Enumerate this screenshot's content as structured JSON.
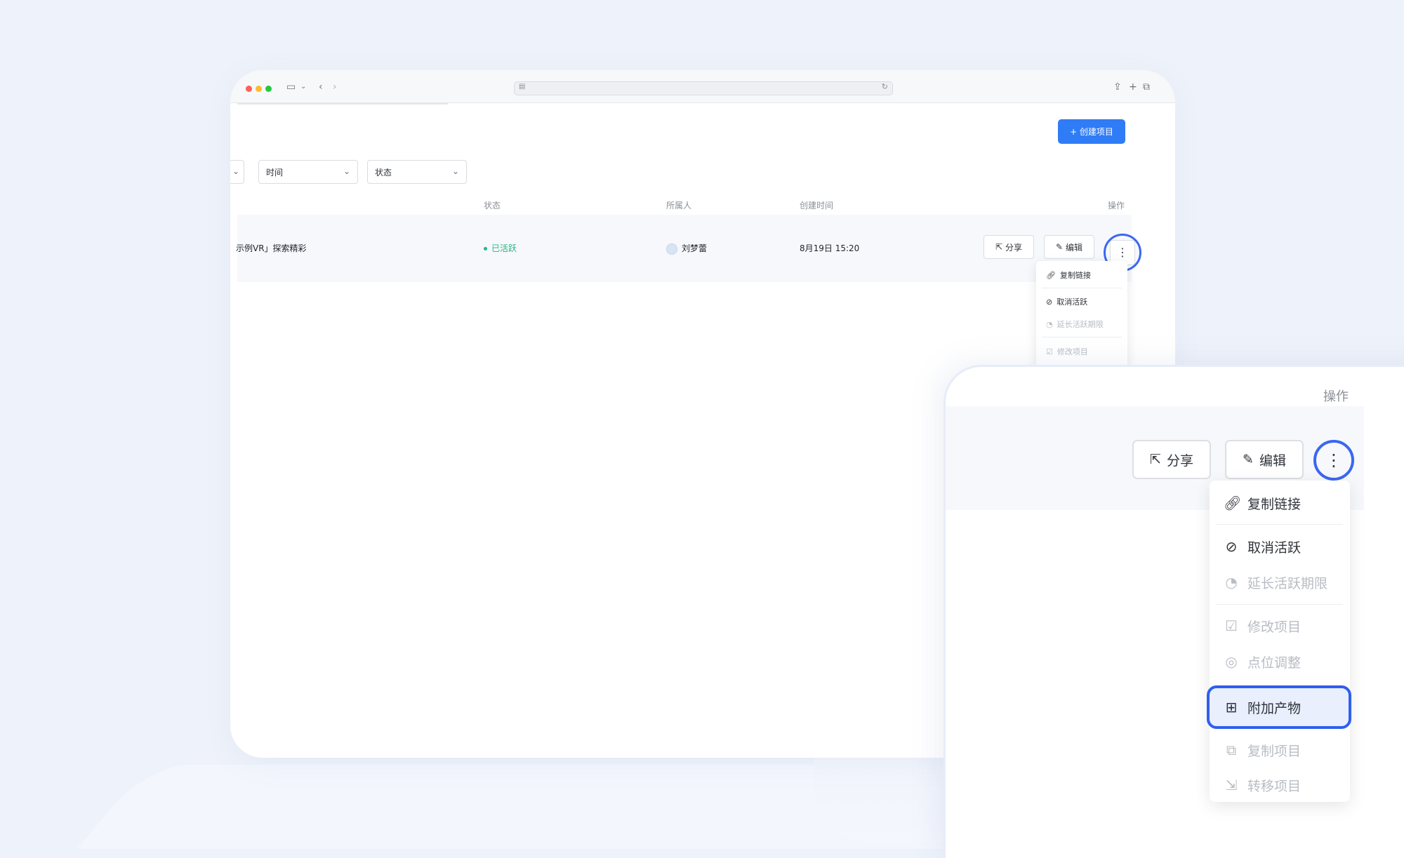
{
  "toolbar": {
    "create_label": "+ 创建项目"
  },
  "filters": [
    {
      "label": "时间"
    },
    {
      "label": "状态"
    }
  ],
  "table": {
    "headers": {
      "status": "状态",
      "owner": "所属人",
      "created": "创建时间",
      "actions": "操作"
    },
    "row": {
      "name": "示例VR」探索精彩",
      "status": "已活跃",
      "owner": "刘梦蕾",
      "created": "8月19日 15:20"
    },
    "buttons": {
      "share": "分享",
      "edit": "编辑"
    }
  },
  "menu": {
    "items": [
      {
        "label": "复制链接",
        "enabled": true,
        "icon": "link-icon"
      },
      {
        "label": "取消活跃",
        "enabled": true,
        "icon": "deactivate-icon"
      },
      {
        "label": "延长活跃期限",
        "enabled": false,
        "icon": "clock-icon"
      },
      {
        "label": "修改项目",
        "enabled": false,
        "icon": "edit-square-icon"
      },
      {
        "label": "点位调整",
        "enabled": false,
        "icon": "target-icon"
      },
      {
        "label": "附加产物",
        "enabled": true,
        "icon": "apps-icon"
      },
      {
        "label": "复制项目",
        "enabled": false,
        "icon": "copy-icon"
      },
      {
        "label": "转移项目",
        "enabled": false,
        "icon": "transfer-icon"
      }
    ]
  },
  "colors": {
    "primary": "#2f7cf6",
    "highlight": "#3b67f0",
    "status_active": "#27b77c"
  }
}
